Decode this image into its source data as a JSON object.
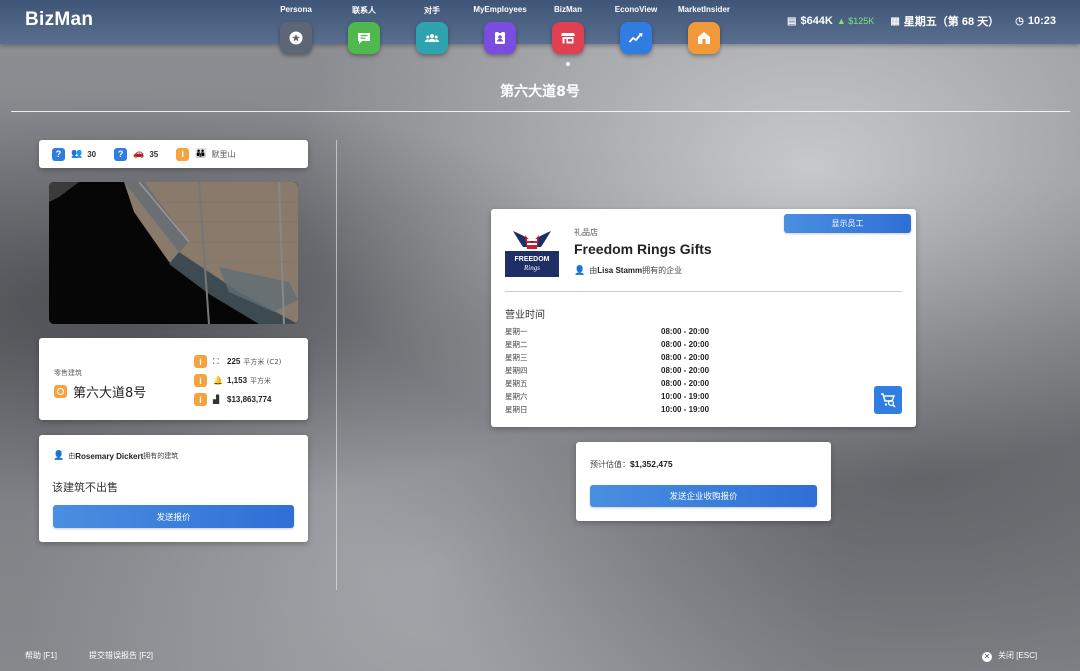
{
  "header": {
    "brand": "BizMan",
    "apps": [
      {
        "label": "Persona",
        "icon": "star-icon",
        "color": "#5d6675"
      },
      {
        "label": "联系人",
        "icon": "chat-icon",
        "color": "#4fb84e"
      },
      {
        "label": "对手",
        "icon": "people-icon",
        "color": "#2fa3b0"
      },
      {
        "label": "MyEmployees",
        "icon": "badge-icon",
        "color": "#7a4de0"
      },
      {
        "label": "BizMan",
        "icon": "store-icon",
        "color": "#e0404f"
      },
      {
        "label": "EconoView",
        "icon": "trend-icon",
        "color": "#2f7de1"
      },
      {
        "label": "MarketInsider",
        "icon": "house-icon",
        "color": "#f09a3a"
      }
    ],
    "money": "$644K",
    "money_gain": "▲ $125K",
    "day": "星期五（第 68 天）",
    "time": "10:23"
  },
  "page_title": "第六大道8号",
  "stats_card": {
    "customers": "30",
    "traffic": "35",
    "district": "默里山"
  },
  "building": {
    "type_label": "零售建筑",
    "name": "第六大道8号",
    "size_value": "225",
    "size_unit": "平方米 (C2)",
    "area_value": "1,153",
    "area_unit": "平方米",
    "price": "$13,863,774"
  },
  "owner_card": {
    "owner_prefix": "由",
    "owner_name": "Rosemary Dickert",
    "owner_suffix": "拥有的建筑",
    "not_for_sale": "该建筑不出售",
    "offer_button": "发送报价"
  },
  "business": {
    "show_employees": "显示员工",
    "category": "礼品店",
    "name": "Freedom Rings Gifts",
    "owner_prefix": "由",
    "owner_name": "Lisa Stamm",
    "owner_suffix": "拥有的企业",
    "logo_line1": "FREEDOM",
    "logo_line2": "Rings",
    "hours_title": "营业时间",
    "hours": [
      {
        "day": "星期一",
        "time": "08:00 - 20:00"
      },
      {
        "day": "星期二",
        "time": "08:00 - 20:00"
      },
      {
        "day": "星期三",
        "time": "08:00 - 20:00"
      },
      {
        "day": "星期四",
        "time": "08:00 - 20:00"
      },
      {
        "day": "星期五",
        "time": "08:00 - 20:00"
      },
      {
        "day": "星期六",
        "time": "10:00 - 19:00"
      },
      {
        "day": "星期日",
        "time": "10:00 - 19:00"
      }
    ]
  },
  "valuation": {
    "label": "预计估值：",
    "value": "$1,352,475",
    "button": "发送企业收购报价"
  },
  "footer": {
    "help": "帮助 [F1]",
    "bug": "提交错误报告 [F2]",
    "close": "关闭 [ESC]"
  }
}
